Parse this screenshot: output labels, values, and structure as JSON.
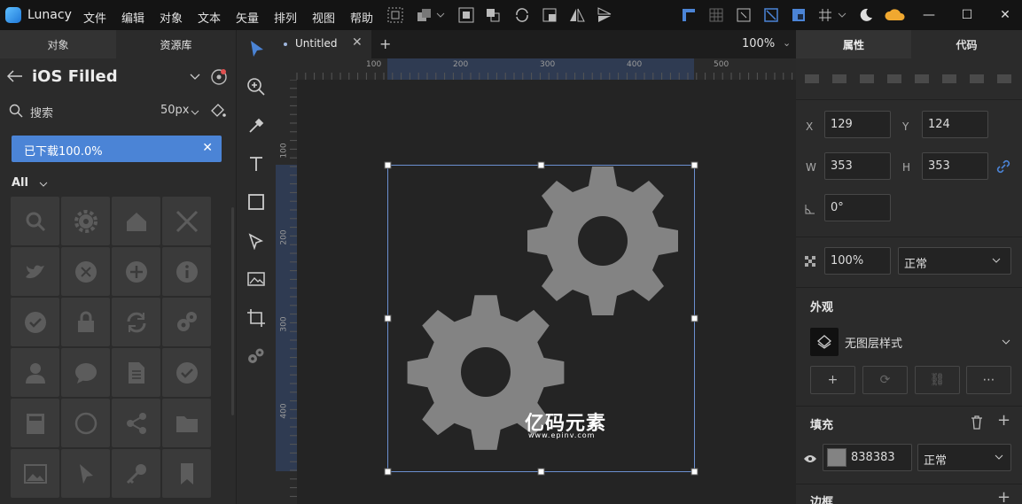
{
  "app": {
    "name": "Lunacy"
  },
  "menu": [
    "文件",
    "编辑",
    "对象",
    "文本",
    "矢量",
    "排列",
    "视图",
    "帮助"
  ],
  "left_panel": {
    "tabs": [
      "对象",
      "资源库"
    ],
    "library_title": "iOS Filled",
    "search_placeholder": "搜索",
    "icon_size": "50px",
    "download_status": "已下载100.0%",
    "download_progress": 1.0,
    "filter_label": "All",
    "icons": [
      "search",
      "gear",
      "home",
      "close",
      "twitter",
      "cancel-circle",
      "add-circle",
      "info",
      "checkmark-circle",
      "lock",
      "refresh",
      "gears",
      "user",
      "chat",
      "document",
      "checkmark-circle",
      "calculator",
      "circle",
      "share",
      "folder",
      "image",
      "cursor",
      "key",
      "bookmark"
    ]
  },
  "document": {
    "tab_title": "Untitled",
    "zoom": "100%"
  },
  "rulers": {
    "horizontal": [
      "100",
      "200",
      "300",
      "400",
      "500"
    ],
    "vertical": [
      "100",
      "200",
      "300",
      "400"
    ]
  },
  "right_panel": {
    "tabs": [
      "属性",
      "代码"
    ],
    "x_label": "X",
    "x": "129",
    "y_label": "Y",
    "y": "124",
    "w_label": "W",
    "w": "353",
    "h_label": "H",
    "h": "353",
    "rotation": "0°",
    "opacity": "100%",
    "blend": "正常",
    "appearance_title": "外观",
    "layer_style": "无图层样式",
    "fill_title": "填充",
    "fill_hex": "838383",
    "fill_color": "#838383",
    "fill_blend": "正常",
    "border_title": "边框"
  },
  "watermark": {
    "text": "亿码元素",
    "url": "www.epinv.com"
  },
  "colors": {
    "accent": "#4b84d6",
    "selection": "#6b8fd0",
    "gear": "#838383"
  }
}
